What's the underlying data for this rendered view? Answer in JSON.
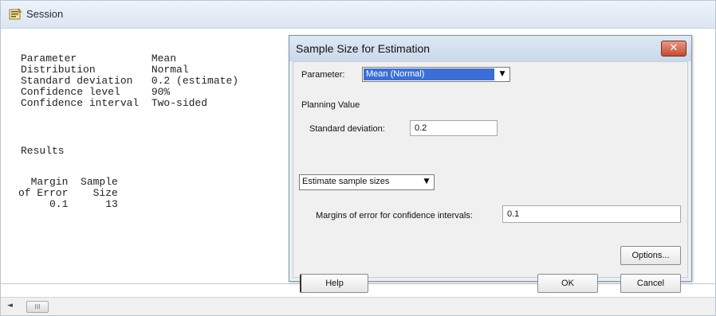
{
  "session": {
    "title": "Session",
    "lines": [
      "Parameter            Mean",
      "Distribution         Normal",
      "Standard deviation   0.2 (estimate)",
      "Confidence level     90%",
      "Confidence interval  Two-sided"
    ],
    "results_heading": "Results",
    "table": [
      "  Margin  Sample",
      "of Error    Size",
      "     0.1      13"
    ],
    "scroll_left": "◄",
    "scroll_thumb": "III"
  },
  "dialog": {
    "title": "Sample Size for Estimation",
    "close": "✕",
    "parameter_label": "Parameter:",
    "parameter_value": "Mean (Normal)",
    "planning_value_label": "Planning Value",
    "std_dev_label": "Standard deviation:",
    "std_dev_value": "0.2",
    "mode_value": "Estimate sample sizes",
    "margins_label": "Margins of error for confidence intervals:",
    "margins_value": "0.1",
    "options_button": "Options...",
    "help_button": "Help",
    "ok_button": "OK",
    "cancel_button": "Cancel",
    "dropdown_arrow": "▼"
  }
}
